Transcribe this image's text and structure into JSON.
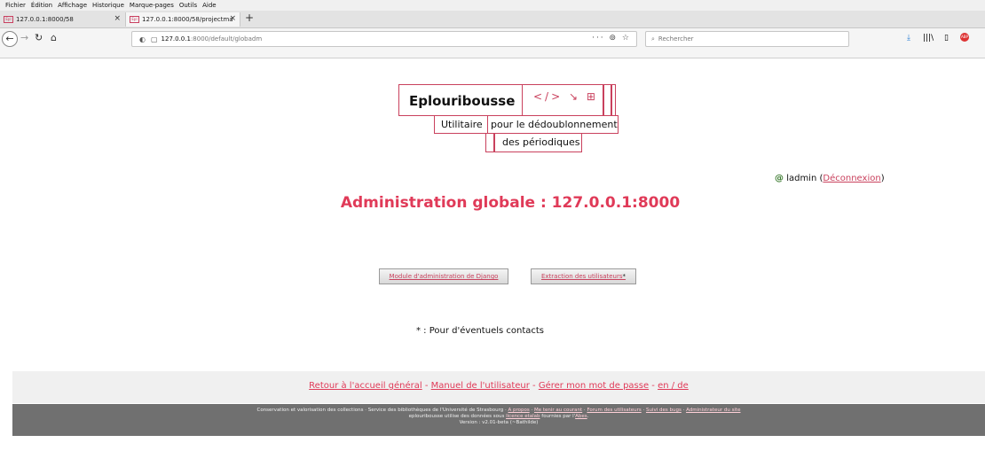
{
  "browser": {
    "menu": [
      "Fichier",
      "Édition",
      "Affichage",
      "Historique",
      "Marque-pages",
      "Outils",
      "Aide"
    ],
    "tabs": [
      {
        "favicon": "Epl",
        "title": "127.0.0.1:8000/58",
        "close": "×"
      },
      {
        "favicon": "Epl",
        "title": "127.0.0.1:8000/58/projectma",
        "close": "×"
      }
    ],
    "new_tab": "+",
    "url_host": "127.0.0.1",
    "url_path": ":8000/default/globadm",
    "url_actions": "··· ⊚ ☆",
    "search_placeholder": "Rechercher",
    "toolbar_icons": [
      "download-icon",
      "library-icon",
      "sidebar-icon",
      "adblock-icon"
    ]
  },
  "logo": {
    "title": "Eplouribousse",
    "icons": "</> ↘ ⊞",
    "line1a": "Utilitaire",
    "line1b": "pour le dédoublonnement",
    "line2": "des périodiques"
  },
  "user": {
    "name": "ladmin",
    "open_paren": "(",
    "logout": "Déconnexion",
    "close_paren": ")"
  },
  "page_title": "Administration globale : 127.0.0.1:8000",
  "buttons": {
    "django_admin": "Module d'administration de Django",
    "extract_users": "Extraction des utilisateurs",
    "extract_star": "*"
  },
  "note": "* : Pour d'éventuels contacts",
  "footer_links": {
    "home": "Retour à l'accueil général",
    "manual": "Manuel de l'utilisateur",
    "password": "Gérer mon mot de passe",
    "lang": "en / de",
    "sep": " - "
  },
  "footer_info": {
    "line1_prefix": "Conservation et valorisation des collections · Service des bibliothèques de l'Université de Strasbourg · ",
    "about": "A propos",
    "keep_informed": "Me tenir au courant",
    "forum": "Forum des utilisateurs",
    "bugs": "Suivi des bugs",
    "site_admin": "Administrateur du site",
    "dot": " · ",
    "line2_prefix": "eplouribousse utilise des données sous ",
    "licence": "licence etalab",
    "line2_mid": " fournies par l'",
    "abes": "Abes",
    "line2_end": ".",
    "version": "Version : v2.01-beta (~Bathilde)"
  },
  "colors": {
    "accent": "#e03a58",
    "logo_border": "#c9415d",
    "footer_dark": "#707070"
  }
}
